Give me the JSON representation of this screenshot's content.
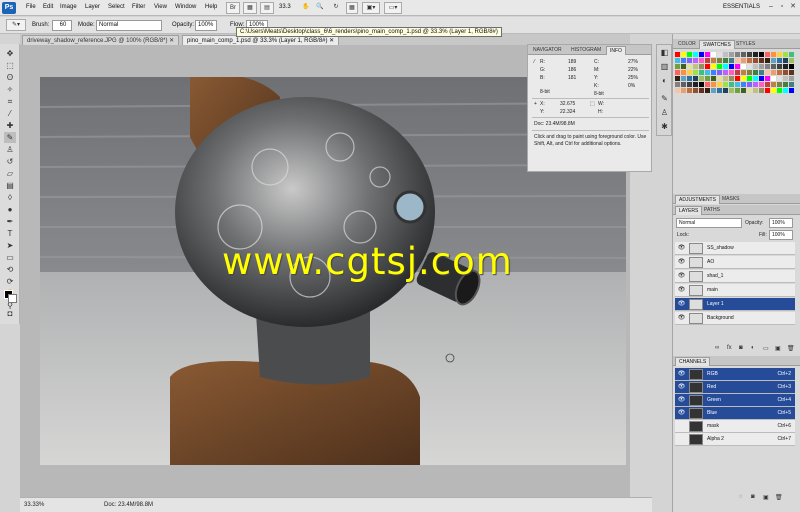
{
  "app": {
    "logo": "Ps",
    "menu": [
      "File",
      "Edit",
      "Image",
      "Layer",
      "Select",
      "Filter",
      "View",
      "Window",
      "Help"
    ],
    "zoom": "33.3",
    "workspace": "ESSENTIALS"
  },
  "options": {
    "brush_label": "Brush:",
    "brush_size": "60",
    "mode_label": "Mode:",
    "mode_value": "Normal",
    "opacity_label": "Opacity:",
    "opacity_value": "100%",
    "flow_label": "Flow:",
    "flow_value": "100%"
  },
  "tooltip": "C:\\Users\\Meats\\Desktop\\class_6\\6_renders\\pino_main_comp_1.psd @ 33.3% (Layer 1, RGB/8#)",
  "doc_tabs": [
    {
      "label": "driveway_shadow_reference.JPG @ 100% (RGB/8*)",
      "active": false
    },
    {
      "label": "pino_main_comp_1.psd @ 33.3% (Layer 1, RGB/8#)",
      "active": true
    }
  ],
  "watermark": "www.cgtsj.com",
  "status": {
    "zoom": "33.33%",
    "doc": "Doc: 23.4M/98.8M"
  },
  "info_panel": {
    "tabs": [
      "NAVIGATOR",
      "HISTOGRAM",
      "INFO"
    ],
    "rgb": {
      "r_label": "R:",
      "r": "189",
      "g_label": "G:",
      "g": "186",
      "b_label": "B:",
      "b": "181"
    },
    "cmyk": {
      "c_label": "C:",
      "c": "27%",
      "m_label": "M:",
      "m": "22%",
      "y_label": "Y:",
      "y": "25%",
      "k_label": "K:",
      "k": "0%"
    },
    "bit1": "8-bit",
    "bit2": "8-bit",
    "x_label": "X:",
    "x": "32.675",
    "y_label": "Y:",
    "y": "22.324",
    "w_label": "W:",
    "h_label": "H:",
    "doc": "Doc: 23.4M/98.8M",
    "hint": "Click and drag to paint using foreground color. Use Shift, Alt, and Ctrl for additional options."
  },
  "color_panel": {
    "tabs": [
      "COLOR",
      "SWATCHES",
      "STYLES"
    ]
  },
  "adjustments_panel": {
    "tabs": [
      "ADJUSTMENTS",
      "MASKS"
    ]
  },
  "layers_panel": {
    "tabs": [
      "LAYERS",
      "PATHS"
    ],
    "blend_mode": "Normal",
    "opacity_label": "Opacity:",
    "opacity": "100%",
    "fill_label": "Fill:",
    "fill": "100%",
    "lock_label": "Lock:",
    "layers": [
      {
        "name": "SS_shadow",
        "selected": false
      },
      {
        "name": "AO",
        "selected": false
      },
      {
        "name": "shad_1",
        "selected": false
      },
      {
        "name": "main",
        "selected": false
      },
      {
        "name": "Layer 1",
        "selected": true
      },
      {
        "name": "Background",
        "selected": false
      }
    ]
  },
  "channels_panel": {
    "title": "CHANNELS",
    "channels": [
      {
        "name": "RGB",
        "shortcut": "Ctrl+2",
        "selected": true
      },
      {
        "name": "Red",
        "shortcut": "Ctrl+3",
        "selected": true
      },
      {
        "name": "Green",
        "shortcut": "Ctrl+4",
        "selected": true
      },
      {
        "name": "Blue",
        "shortcut": "Ctrl+5",
        "selected": true
      },
      {
        "name": "mask",
        "shortcut": "Ctrl+6",
        "selected": false
      },
      {
        "name": "Alpha 2",
        "shortcut": "Ctrl+7",
        "selected": false
      }
    ]
  },
  "colors": {
    "selected_row": "#264c99",
    "watermark": "#ffff00",
    "ps_blue": "#1b64b8"
  }
}
